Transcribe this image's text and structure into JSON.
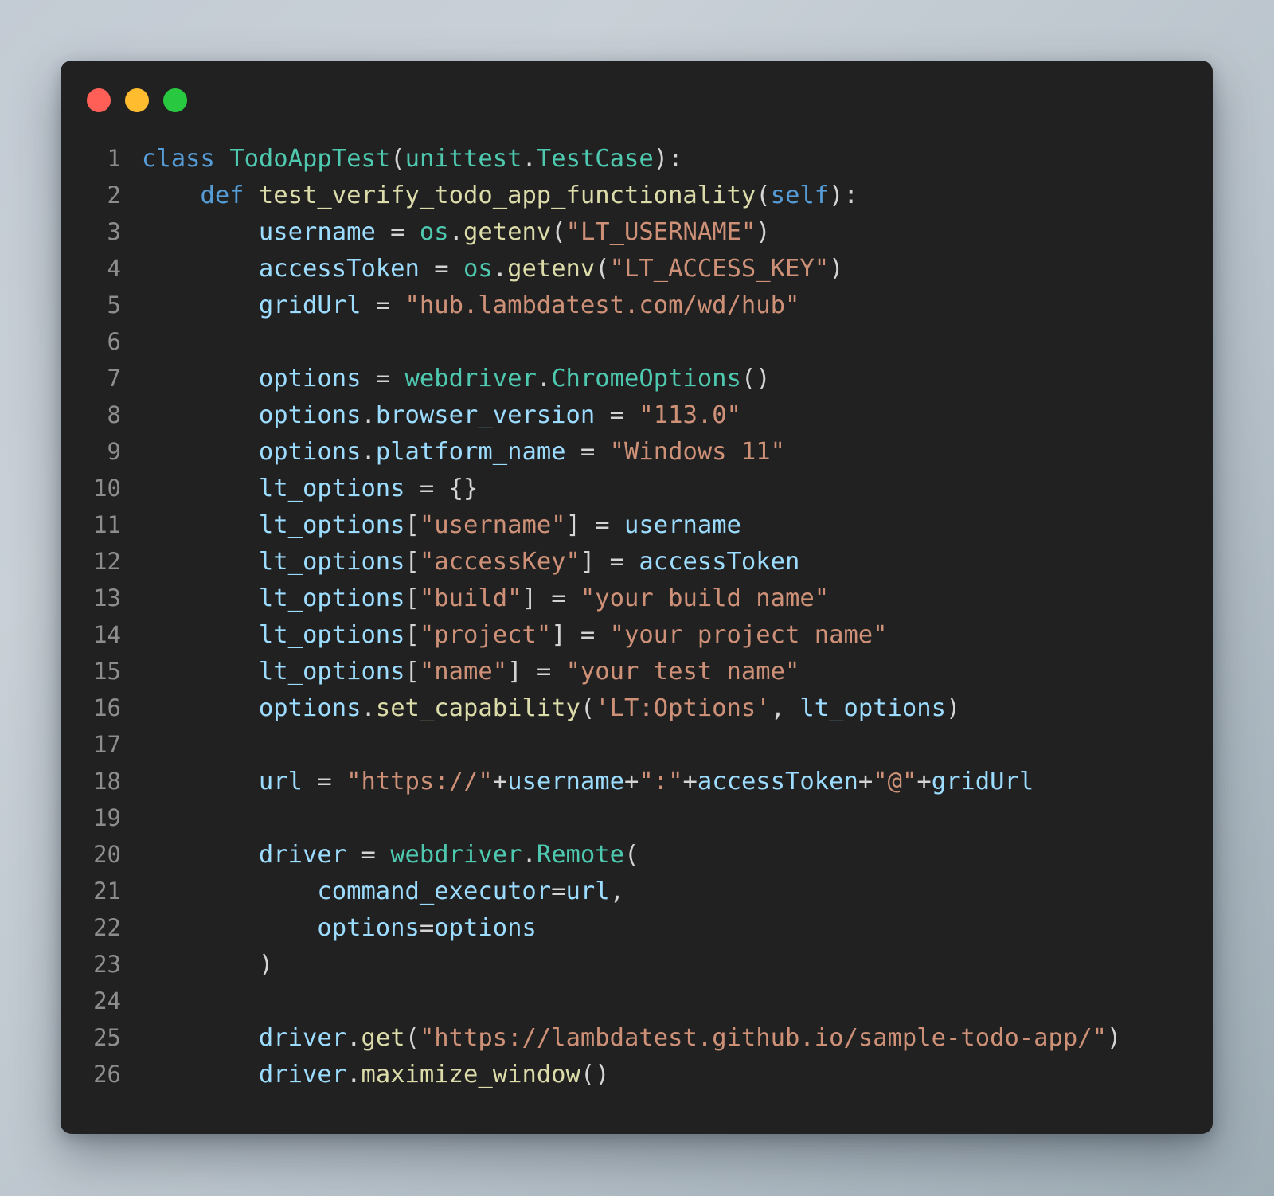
{
  "window": {
    "title_bar": {
      "buttons": [
        {
          "name": "close",
          "color": "#ff5f57"
        },
        {
          "name": "minimize",
          "color": "#febc2e"
        },
        {
          "name": "maximize",
          "color": "#28c840"
        }
      ]
    },
    "background_color": "#212121",
    "desktop_background": "#c3cbd4"
  },
  "editor": {
    "language": "python",
    "theme_colors": {
      "keyword": "#569cd6",
      "function": "#dcdcaa",
      "class": "#4ec9b0",
      "variable": "#9cdcfe",
      "string": "#ce9178",
      "operator": "#d4d4d4",
      "line_number": "#8d8d8d",
      "background": "#212121"
    },
    "lines": [
      {
        "num": "1",
        "tokens": [
          {
            "t": "class",
            "c": "kw"
          },
          {
            "t": " ",
            "c": "op"
          },
          {
            "t": "TodoAppTest",
            "c": "cls"
          },
          {
            "t": "(",
            "c": "op"
          },
          {
            "t": "unittest",
            "c": "cls"
          },
          {
            "t": ".",
            "c": "op"
          },
          {
            "t": "TestCase",
            "c": "cls"
          },
          {
            "t": "):",
            "c": "op"
          }
        ]
      },
      {
        "num": "2",
        "tokens": [
          {
            "t": "    ",
            "c": "op"
          },
          {
            "t": "def",
            "c": "kw"
          },
          {
            "t": " ",
            "c": "op"
          },
          {
            "t": "test_verify_todo_app_functionality",
            "c": "fn"
          },
          {
            "t": "(",
            "c": "op"
          },
          {
            "t": "self",
            "c": "self"
          },
          {
            "t": "):",
            "c": "op"
          }
        ]
      },
      {
        "num": "3",
        "tokens": [
          {
            "t": "        ",
            "c": "op"
          },
          {
            "t": "username",
            "c": "var"
          },
          {
            "t": " = ",
            "c": "op"
          },
          {
            "t": "os",
            "c": "cls"
          },
          {
            "t": ".",
            "c": "op"
          },
          {
            "t": "getenv",
            "c": "fn"
          },
          {
            "t": "(",
            "c": "op"
          },
          {
            "t": "\"LT_USERNAME\"",
            "c": "str"
          },
          {
            "t": ")",
            "c": "op"
          }
        ]
      },
      {
        "num": "4",
        "tokens": [
          {
            "t": "        ",
            "c": "op"
          },
          {
            "t": "accessToken",
            "c": "var"
          },
          {
            "t": " = ",
            "c": "op"
          },
          {
            "t": "os",
            "c": "cls"
          },
          {
            "t": ".",
            "c": "op"
          },
          {
            "t": "getenv",
            "c": "fn"
          },
          {
            "t": "(",
            "c": "op"
          },
          {
            "t": "\"LT_ACCESS_KEY\"",
            "c": "str"
          },
          {
            "t": ")",
            "c": "op"
          }
        ]
      },
      {
        "num": "5",
        "tokens": [
          {
            "t": "        ",
            "c": "op"
          },
          {
            "t": "gridUrl",
            "c": "var"
          },
          {
            "t": " = ",
            "c": "op"
          },
          {
            "t": "\"hub.lambdatest.com/wd/hub\"",
            "c": "str"
          }
        ]
      },
      {
        "num": "6",
        "tokens": []
      },
      {
        "num": "7",
        "tokens": [
          {
            "t": "        ",
            "c": "op"
          },
          {
            "t": "options",
            "c": "var"
          },
          {
            "t": " = ",
            "c": "op"
          },
          {
            "t": "webdriver",
            "c": "cls"
          },
          {
            "t": ".",
            "c": "op"
          },
          {
            "t": "ChromeOptions",
            "c": "cls"
          },
          {
            "t": "()",
            "c": "op"
          }
        ]
      },
      {
        "num": "8",
        "tokens": [
          {
            "t": "        ",
            "c": "op"
          },
          {
            "t": "options",
            "c": "var"
          },
          {
            "t": ".",
            "c": "op"
          },
          {
            "t": "browser_version",
            "c": "var"
          },
          {
            "t": " = ",
            "c": "op"
          },
          {
            "t": "\"113.0\"",
            "c": "str"
          }
        ]
      },
      {
        "num": "9",
        "tokens": [
          {
            "t": "        ",
            "c": "op"
          },
          {
            "t": "options",
            "c": "var"
          },
          {
            "t": ".",
            "c": "op"
          },
          {
            "t": "platform_name",
            "c": "var"
          },
          {
            "t": " = ",
            "c": "op"
          },
          {
            "t": "\"Windows 11\"",
            "c": "str"
          }
        ]
      },
      {
        "num": "10",
        "tokens": [
          {
            "t": "        ",
            "c": "op"
          },
          {
            "t": "lt_options",
            "c": "var"
          },
          {
            "t": " = ",
            "c": "op"
          },
          {
            "t": "{}",
            "c": "op"
          }
        ]
      },
      {
        "num": "11",
        "tokens": [
          {
            "t": "        ",
            "c": "op"
          },
          {
            "t": "lt_options",
            "c": "var"
          },
          {
            "t": "[",
            "c": "op"
          },
          {
            "t": "\"username\"",
            "c": "str"
          },
          {
            "t": "] = ",
            "c": "op"
          },
          {
            "t": "username",
            "c": "var"
          }
        ]
      },
      {
        "num": "12",
        "tokens": [
          {
            "t": "        ",
            "c": "op"
          },
          {
            "t": "lt_options",
            "c": "var"
          },
          {
            "t": "[",
            "c": "op"
          },
          {
            "t": "\"accessKey\"",
            "c": "str"
          },
          {
            "t": "] = ",
            "c": "op"
          },
          {
            "t": "accessToken",
            "c": "var"
          }
        ]
      },
      {
        "num": "13",
        "tokens": [
          {
            "t": "        ",
            "c": "op"
          },
          {
            "t": "lt_options",
            "c": "var"
          },
          {
            "t": "[",
            "c": "op"
          },
          {
            "t": "\"build\"",
            "c": "str"
          },
          {
            "t": "] = ",
            "c": "op"
          },
          {
            "t": "\"your build name\"",
            "c": "str"
          }
        ]
      },
      {
        "num": "14",
        "tokens": [
          {
            "t": "        ",
            "c": "op"
          },
          {
            "t": "lt_options",
            "c": "var"
          },
          {
            "t": "[",
            "c": "op"
          },
          {
            "t": "\"project\"",
            "c": "str"
          },
          {
            "t": "] = ",
            "c": "op"
          },
          {
            "t": "\"your project name\"",
            "c": "str"
          }
        ]
      },
      {
        "num": "15",
        "tokens": [
          {
            "t": "        ",
            "c": "op"
          },
          {
            "t": "lt_options",
            "c": "var"
          },
          {
            "t": "[",
            "c": "op"
          },
          {
            "t": "\"name\"",
            "c": "str"
          },
          {
            "t": "] = ",
            "c": "op"
          },
          {
            "t": "\"your test name\"",
            "c": "str"
          }
        ]
      },
      {
        "num": "16",
        "tokens": [
          {
            "t": "        ",
            "c": "op"
          },
          {
            "t": "options",
            "c": "var"
          },
          {
            "t": ".",
            "c": "op"
          },
          {
            "t": "set_capability",
            "c": "fn"
          },
          {
            "t": "(",
            "c": "op"
          },
          {
            "t": "'LT:Options'",
            "c": "str"
          },
          {
            "t": ", ",
            "c": "op"
          },
          {
            "t": "lt_options",
            "c": "var"
          },
          {
            "t": ")",
            "c": "op"
          }
        ]
      },
      {
        "num": "17",
        "tokens": []
      },
      {
        "num": "18",
        "tokens": [
          {
            "t": "        ",
            "c": "op"
          },
          {
            "t": "url",
            "c": "var"
          },
          {
            "t": " = ",
            "c": "op"
          },
          {
            "t": "\"https://\"",
            "c": "str"
          },
          {
            "t": "+",
            "c": "op"
          },
          {
            "t": "username",
            "c": "var"
          },
          {
            "t": "+",
            "c": "op"
          },
          {
            "t": "\":\"",
            "c": "str"
          },
          {
            "t": "+",
            "c": "op"
          },
          {
            "t": "accessToken",
            "c": "var"
          },
          {
            "t": "+",
            "c": "op"
          },
          {
            "t": "\"@\"",
            "c": "str"
          },
          {
            "t": "+",
            "c": "op"
          },
          {
            "t": "gridUrl",
            "c": "var"
          }
        ]
      },
      {
        "num": "19",
        "tokens": []
      },
      {
        "num": "20",
        "tokens": [
          {
            "t": "        ",
            "c": "op"
          },
          {
            "t": "driver",
            "c": "var"
          },
          {
            "t": " = ",
            "c": "op"
          },
          {
            "t": "webdriver",
            "c": "cls"
          },
          {
            "t": ".",
            "c": "op"
          },
          {
            "t": "Remote",
            "c": "cls"
          },
          {
            "t": "(",
            "c": "op"
          }
        ]
      },
      {
        "num": "21",
        "tokens": [
          {
            "t": "            ",
            "c": "op"
          },
          {
            "t": "command_executor",
            "c": "var"
          },
          {
            "t": "=",
            "c": "op"
          },
          {
            "t": "url",
            "c": "var"
          },
          {
            "t": ",",
            "c": "op"
          }
        ]
      },
      {
        "num": "22",
        "tokens": [
          {
            "t": "            ",
            "c": "op"
          },
          {
            "t": "options",
            "c": "var"
          },
          {
            "t": "=",
            "c": "op"
          },
          {
            "t": "options",
            "c": "var"
          }
        ]
      },
      {
        "num": "23",
        "tokens": [
          {
            "t": "        ",
            "c": "op"
          },
          {
            "t": ")",
            "c": "op"
          }
        ]
      },
      {
        "num": "24",
        "tokens": []
      },
      {
        "num": "25",
        "tokens": [
          {
            "t": "        ",
            "c": "op"
          },
          {
            "t": "driver",
            "c": "var"
          },
          {
            "t": ".",
            "c": "op"
          },
          {
            "t": "get",
            "c": "fn"
          },
          {
            "t": "(",
            "c": "op"
          },
          {
            "t": "\"https://lambdatest.github.io/sample-todo-app/\"",
            "c": "str"
          },
          {
            "t": ")",
            "c": "op"
          }
        ]
      },
      {
        "num": "26",
        "tokens": [
          {
            "t": "        ",
            "c": "op"
          },
          {
            "t": "driver",
            "c": "var"
          },
          {
            "t": ".",
            "c": "op"
          },
          {
            "t": "maximize_window",
            "c": "fn"
          },
          {
            "t": "()",
            "c": "op"
          }
        ]
      }
    ]
  }
}
